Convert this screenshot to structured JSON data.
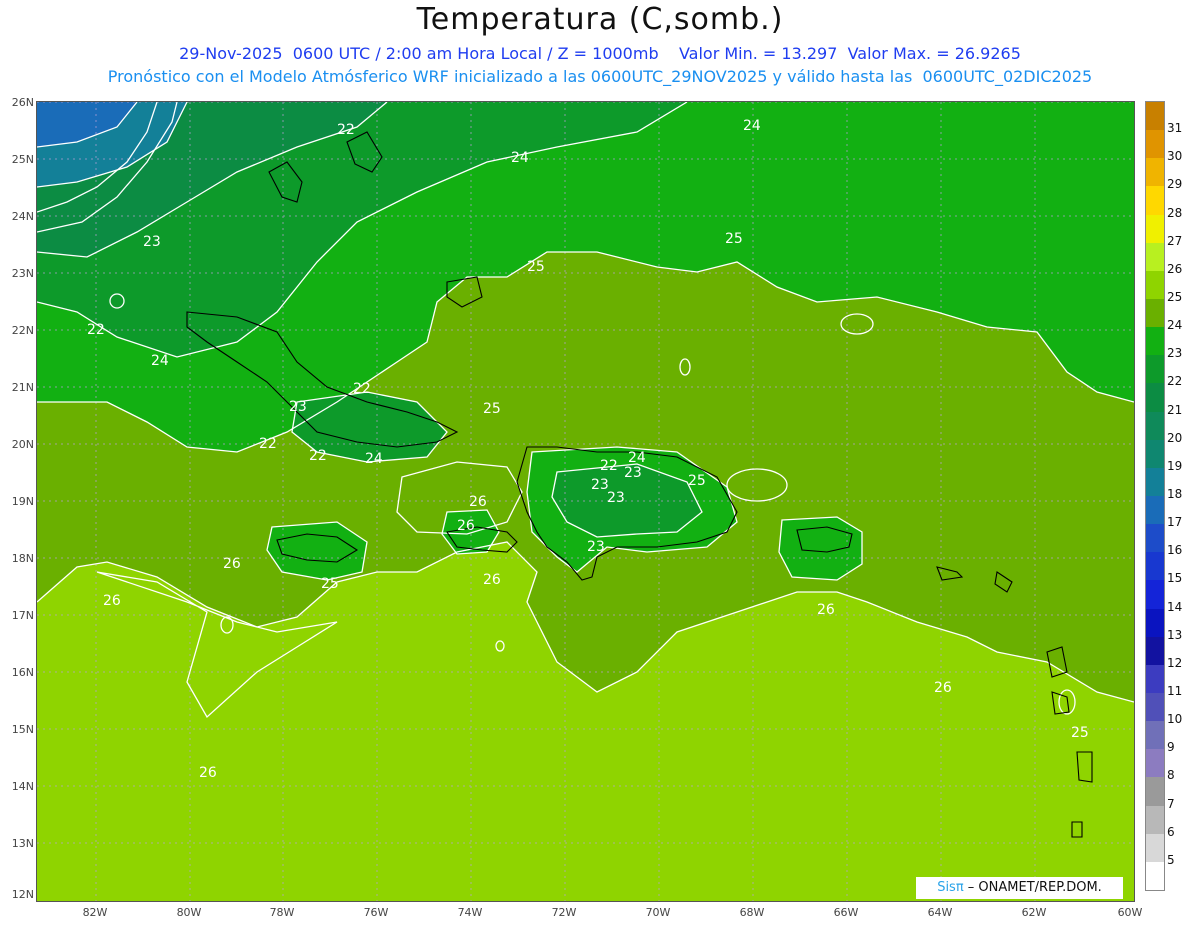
{
  "header": {
    "title": "Temperatura (C,somb.)",
    "line1": "29-Nov-2025  0600 UTC / 2:00 am Hora Local / Z = 1000mb    Valor Min. = 13.297  Valor Max. = 26.9265",
    "line2": "Pronóstico con el Modelo Atmósferico WRF inicializado a las 0600UTC_29NOV2025 y válido hasta las  0600UTC_02DIC2025"
  },
  "map": {
    "lat_labels": [
      "26N",
      "25N",
      "24N",
      "23N",
      "22N",
      "21N",
      "20N",
      "19N",
      "18N",
      "17N",
      "16N",
      "15N",
      "14N",
      "13N",
      "12N"
    ],
    "lon_labels": [
      "82W",
      "80W",
      "78W",
      "76W",
      "74W",
      "72W",
      "70W",
      "68W",
      "66W",
      "64W",
      "62W",
      "60W"
    ],
    "contour_labels": [
      "22",
      "24",
      "24",
      "23",
      "25",
      "25",
      "22",
      "24",
      "22",
      "23",
      "22",
      "25",
      "22",
      "24",
      "22",
      "24",
      "23",
      "25",
      "26",
      "23",
      "23",
      "26",
      "25",
      "26",
      "26",
      "26",
      "26",
      "26",
      "25",
      "23",
      "26"
    ]
  },
  "colorbar": {
    "labels": [
      "31",
      "30",
      "29",
      "28",
      "27",
      "26",
      "25",
      "24",
      "23",
      "22",
      "21",
      "20",
      "19",
      "18",
      "17",
      "16",
      "15",
      "14",
      "13",
      "12",
      "11",
      "10",
      "9",
      "8",
      "7",
      "6",
      "5"
    ],
    "colors": [
      "#c88000",
      "#e09400",
      "#f0b400",
      "#ffd800",
      "#f0f000",
      "#b8f020",
      "#8fd400",
      "#6ab000",
      "#12b012",
      "#0d9a2a",
      "#0c8c43",
      "#0f8a5a",
      "#0f8770",
      "#138098",
      "#1a6cb8",
      "#1d4cc9",
      "#1838d0",
      "#1424d8",
      "#0a14c0",
      "#1212a0",
      "#3c3cc0",
      "#5050b8",
      "#7070b8",
      "#8c7cc0",
      "#9a9a9a",
      "#b8b8b8",
      "#d8d8d8",
      "#ffffff"
    ]
  },
  "credit": {
    "brand": "Sisπ",
    "org": " – ONAMET/REP.DOM."
  }
}
